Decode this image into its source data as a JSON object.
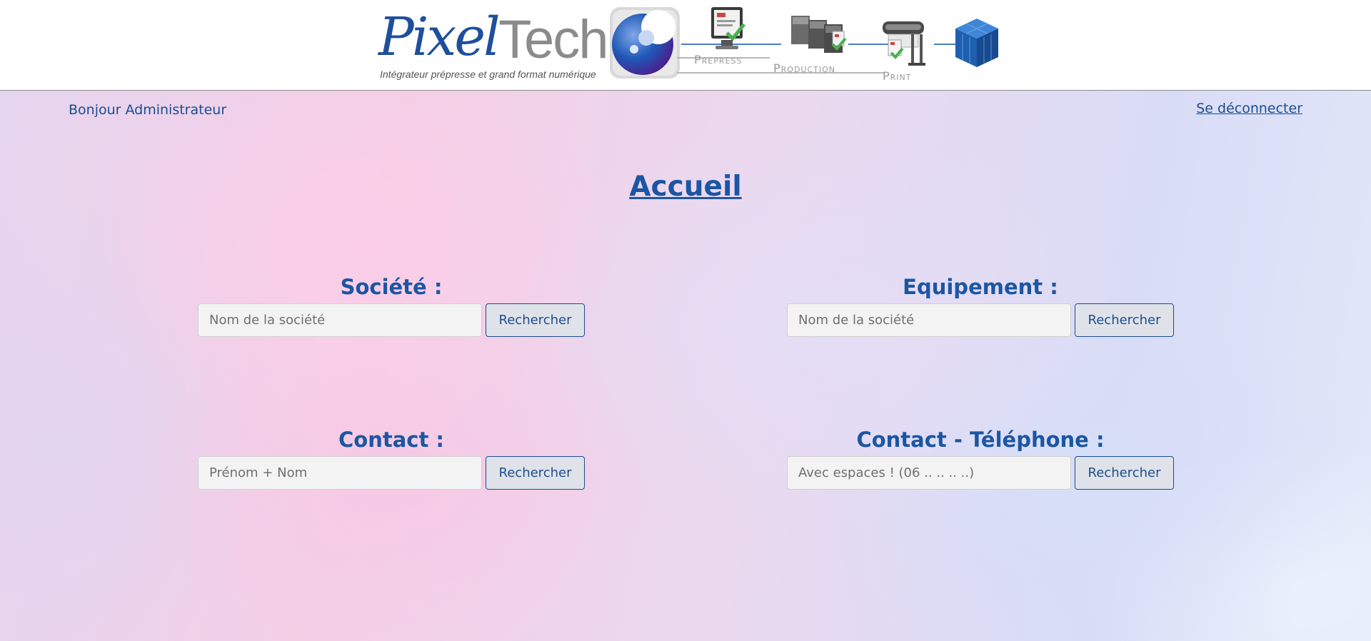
{
  "header": {
    "logo_word_1": "Pixel",
    "logo_word_2": "Tech",
    "logo_tagline": "Intégrateur prépresse et grand format numérique",
    "stages": [
      "Prepress",
      "Production",
      "Print"
    ],
    "brand_blue": "#1f4f9c",
    "brand_grey": "#8b8b8b"
  },
  "user_bar": {
    "greeting": "Bonjour Administrateur",
    "logout_label": "Se déconnecter"
  },
  "page_title": "Accueil",
  "searches": [
    {
      "label": "Société :",
      "placeholder": "Nom de la société",
      "button_label": "Rechercher"
    },
    {
      "label": "Equipement :",
      "placeholder": "Nom de la société",
      "button_label": "Rechercher"
    },
    {
      "label": "Contact :",
      "placeholder": "Prénom + Nom",
      "button_label": "Rechercher"
    },
    {
      "label": "Contact - Téléphone :",
      "placeholder": "Avec espaces ! (06 .. .. .. ..)",
      "button_label": "Rechercher"
    }
  ],
  "colors": {
    "accent": "#1b56a3",
    "link": "#1b4e8f",
    "input_bg": "#f3f3f3",
    "button_bg": "#dfe2e8"
  }
}
